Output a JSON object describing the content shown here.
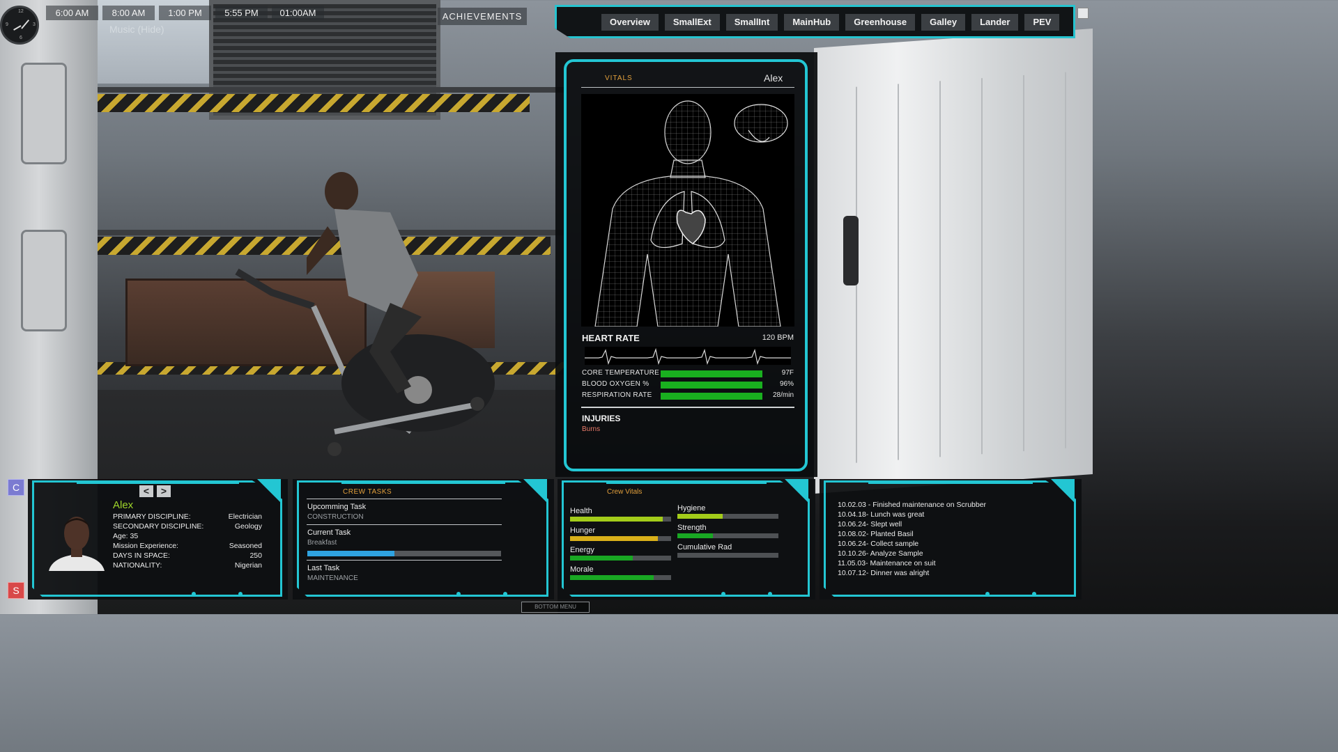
{
  "clock": {
    "numbers": [
      "12",
      "3",
      "6",
      "9"
    ]
  },
  "times": [
    "6:00 AM",
    "8:00 AM",
    "1:00 PM",
    "5:55 PM",
    "01:00AM"
  ],
  "music_label": "Music (Hide)",
  "achievements_label": "ACHIEVEMENTS",
  "tabs": [
    "Overview",
    "SmallExt",
    "SmallInt",
    "MainHub",
    "Greenhouse",
    "Galley",
    "Lander",
    "PEV"
  ],
  "vitals": {
    "tab_label": "VITALS",
    "crew_name": "Alex",
    "heart_rate_label": "HEART RATE",
    "heart_rate_value": "120 BPM",
    "stats": [
      {
        "label": "CORE TEMPERATURE",
        "value": "97F",
        "fill": 1.0
      },
      {
        "label": "BLOOD OXYGEN %",
        "value": "96%",
        "fill": 1.0
      },
      {
        "label": "RESPIRATION RATE",
        "value": "28/min",
        "fill": 1.0
      }
    ],
    "injuries_label": "INJURIES",
    "injuries": [
      "Burns"
    ]
  },
  "side_buttons": {
    "c": "C",
    "s": "S"
  },
  "crew_panel": {
    "prev": "<",
    "next": ">",
    "name": "Alex",
    "fields": [
      {
        "label": "PRIMARY DISCIPLINE:",
        "value": "Electrician"
      },
      {
        "label": "SECONDARY DISCIPLINE:",
        "value": "Geology"
      },
      {
        "label": "Age: 35",
        "value": ""
      },
      {
        "label": "Mission Experience:",
        "value": "Seasoned"
      },
      {
        "label": "DAYS IN SPACE:",
        "value": "250"
      },
      {
        "label": "NATIONALITY:",
        "value": "Nigerian"
      }
    ]
  },
  "crew_tasks": {
    "title": "CREW TASKS",
    "upcoming_label": "Upcomming Task",
    "upcoming_value": "CONSTRUCTION",
    "current_label": "Current Task",
    "current_value": "Breakfast",
    "current_progress": 0.45,
    "last_label": "Last Task",
    "last_value": "MAINTENANCE"
  },
  "crew_vitals": {
    "title": "Crew Vitals",
    "left": [
      {
        "label": "Health",
        "fill": 0.92,
        "color": "#a3cc1a"
      },
      {
        "label": "Hunger",
        "fill": 0.87,
        "color": "#d9b01a"
      },
      {
        "label": "Energy",
        "fill": 0.62,
        "color": "#19a823"
      },
      {
        "label": "Morale",
        "fill": 0.83,
        "color": "#19a823"
      }
    ],
    "right": [
      {
        "label": "Hygiene",
        "fill": 0.45,
        "color": "#a3cc1a"
      },
      {
        "label": "Strength",
        "fill": 0.35,
        "color": "#19a823"
      },
      {
        "label": "Cumulative Rad",
        "fill": 0.0,
        "color": "#19a823"
      }
    ]
  },
  "log": [
    "10.02.03 - Finished maintenance on Scrubber",
    "10.04.18- Lunch was great",
    "10.06.24- Slept well",
    "10.08.02- Planted Basil",
    "10.06.24- Collect sample",
    "10.10.26- Analyze Sample",
    "11.05.03- Maintenance on suit",
    "10.07.12- Dinner was alright"
  ],
  "bottom_menu_label": "BOTTOM MENU"
}
